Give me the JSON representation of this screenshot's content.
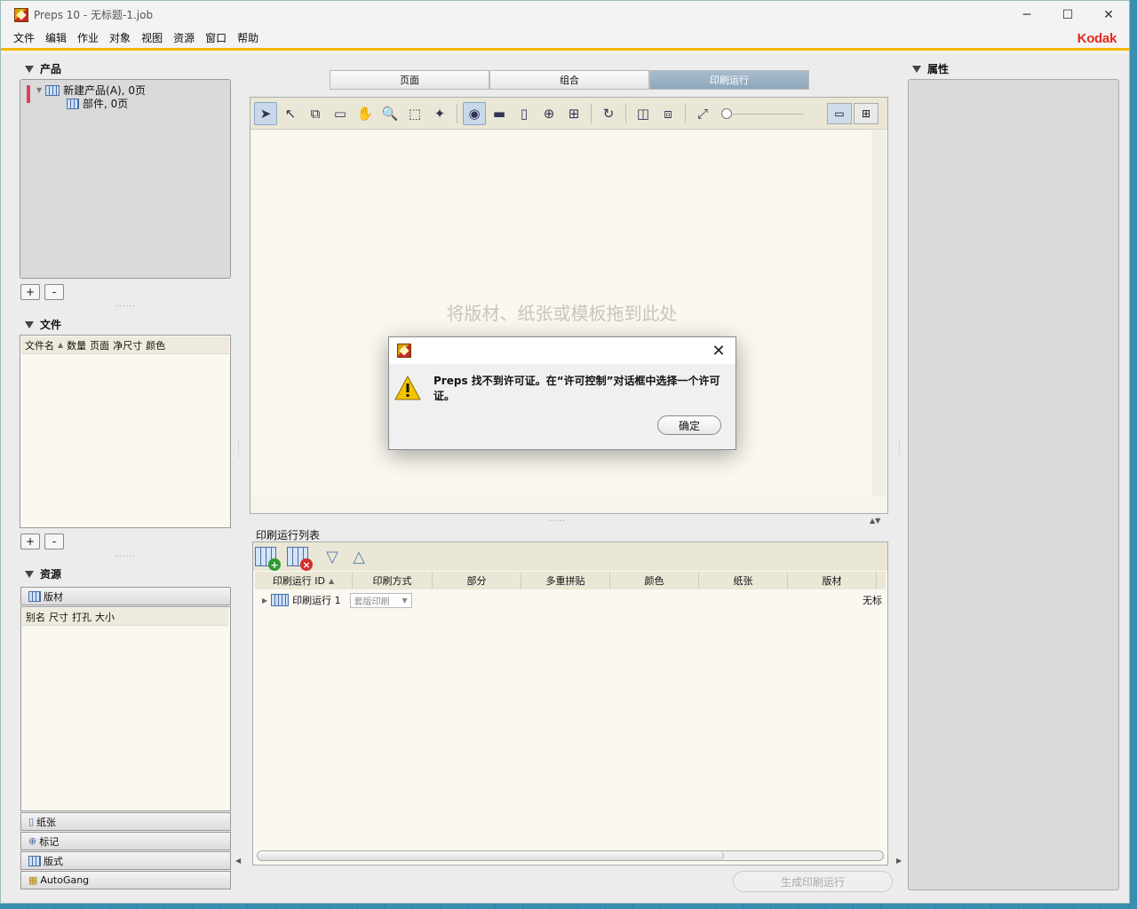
{
  "window": {
    "title": "Preps 10 - 无标题-1.job",
    "brand": "Kodak"
  },
  "menu": [
    "文件",
    "编辑",
    "作业",
    "对象",
    "视图",
    "资源",
    "窗口",
    "帮助"
  ],
  "products_panel": {
    "title": "产品",
    "tree": [
      {
        "label": "新建产品(A), 0页",
        "level": 0
      },
      {
        "label": "部件, 0页",
        "level": 1
      }
    ],
    "add": "+",
    "remove": "-"
  },
  "files_panel": {
    "title": "文件",
    "columns": [
      "文件名",
      "数量",
      "页面",
      "净尺寸",
      "颜色"
    ],
    "add": "+",
    "remove": "-"
  },
  "resources_panel": {
    "title": "资源",
    "plates_tab": "版材",
    "columns": [
      "别名",
      "尺寸",
      "打孔",
      "大小"
    ],
    "tabs": [
      "纸张",
      "标记",
      "版式",
      "AutoGang"
    ]
  },
  "center_tabs": [
    "页面",
    "组合",
    "印刷运行"
  ],
  "drop_hint": "将版材、纸张或模板拖到此处",
  "run_list": {
    "title": "印刷运行列表",
    "columns": [
      "印刷运行 ID",
      "印刷方式",
      "部分",
      "多重拼贴",
      "颜色",
      "纸张",
      "版材"
    ],
    "row": {
      "name": "印刷运行 1",
      "method": "套版印刷",
      "trailing": "无标"
    },
    "generate_button": "生成印刷运行"
  },
  "properties_panel": {
    "title": "属性"
  },
  "dialog": {
    "message_app": "Preps",
    "message": " 找不到许可证。在“许可控制”对话框中选择一个许可证。",
    "ok": "确定"
  }
}
